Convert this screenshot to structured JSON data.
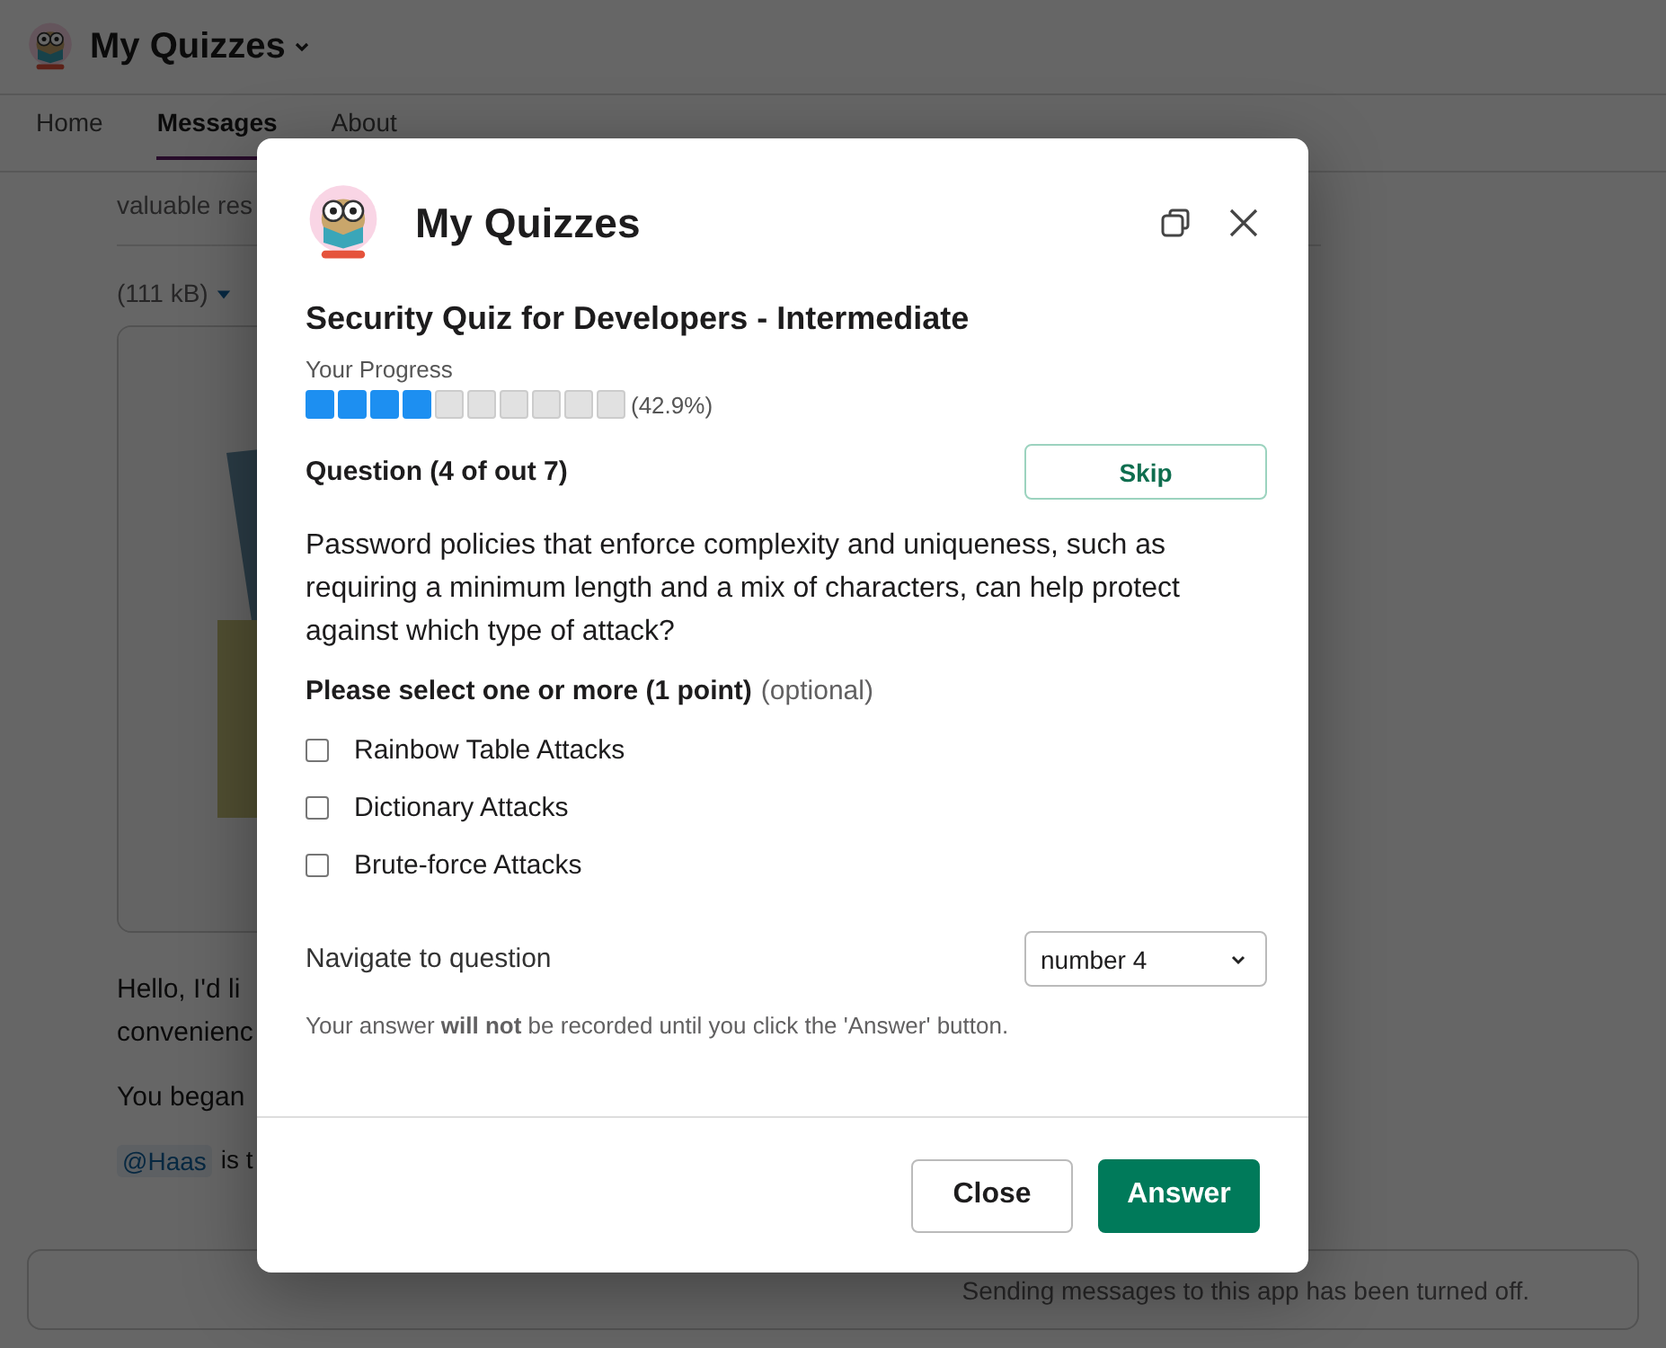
{
  "app_header": {
    "title": "My Quizzes"
  },
  "tabs": [
    {
      "label": "Home",
      "selected": false
    },
    {
      "label": "Messages",
      "selected": true
    },
    {
      "label": "About",
      "selected": false
    }
  ],
  "messages": {
    "snippet": "valuable res",
    "file_size": "(111 kB)",
    "image": {
      "kind": "picture"
    },
    "greeting_lines": [
      "Hello, I'd li",
      "convenienc"
    ],
    "began": "You began",
    "mention": "@Haas",
    "mention_rest": "is t"
  },
  "composer": {
    "notice": "Sending messages to this app has been turned off."
  },
  "modal": {
    "title": "My Quizzes",
    "quiz_title": "Security Quiz for Developers - Intermediate",
    "progress_label": "Your Progress",
    "progress": {
      "level": 0.4,
      "reading": "(42.9%)"
    },
    "question_label": "Question (4 of out 7)",
    "skip": "Skip",
    "question": "Password policies that enforce complexity and uniqueness, such as requiring a minimum length and a mix of characters, can help protect against which type of attack?",
    "instruction": "Please select one or more (1 point)",
    "instruction_note": "(optional)",
    "options": [
      {
        "label": "Rainbow Table Attacks",
        "checked": false
      },
      {
        "label": "Dictionary Attacks",
        "checked": false
      },
      {
        "label": "Brute-force Attacks",
        "checked": false
      }
    ],
    "navigate_label": "Navigate to question",
    "navigate_value": "number 4",
    "note": "Your answer **will not** be recorded until you click the 'Answer' button.",
    "buttons": [
      "Close",
      "Answer"
    ]
  }
}
